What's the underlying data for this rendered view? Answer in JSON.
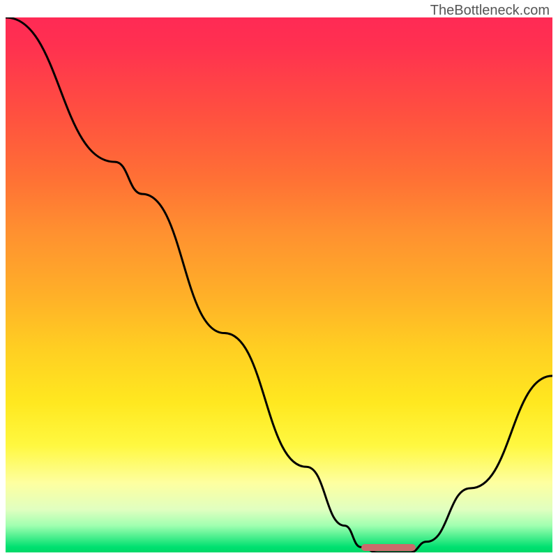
{
  "watermark": "TheBottleneck.com",
  "chart_data": {
    "type": "line",
    "title": "",
    "xlabel": "",
    "ylabel": "",
    "x_range": [
      0,
      100
    ],
    "y_range": [
      0,
      100
    ],
    "curve_points": [
      {
        "x": 0,
        "y": 100
      },
      {
        "x": 20,
        "y": 73
      },
      {
        "x": 25,
        "y": 67
      },
      {
        "x": 40,
        "y": 41
      },
      {
        "x": 55,
        "y": 16
      },
      {
        "x": 62,
        "y": 5
      },
      {
        "x": 65,
        "y": 1
      },
      {
        "x": 68,
        "y": 0
      },
      {
        "x": 74,
        "y": 0
      },
      {
        "x": 77,
        "y": 2
      },
      {
        "x": 85,
        "y": 12
      },
      {
        "x": 100,
        "y": 33
      }
    ],
    "optimal_range": {
      "start": 65,
      "end": 75
    },
    "gradient_colors": {
      "top": "#ff2a55",
      "middle": "#ffcf22",
      "bottom": "#00d868"
    }
  }
}
